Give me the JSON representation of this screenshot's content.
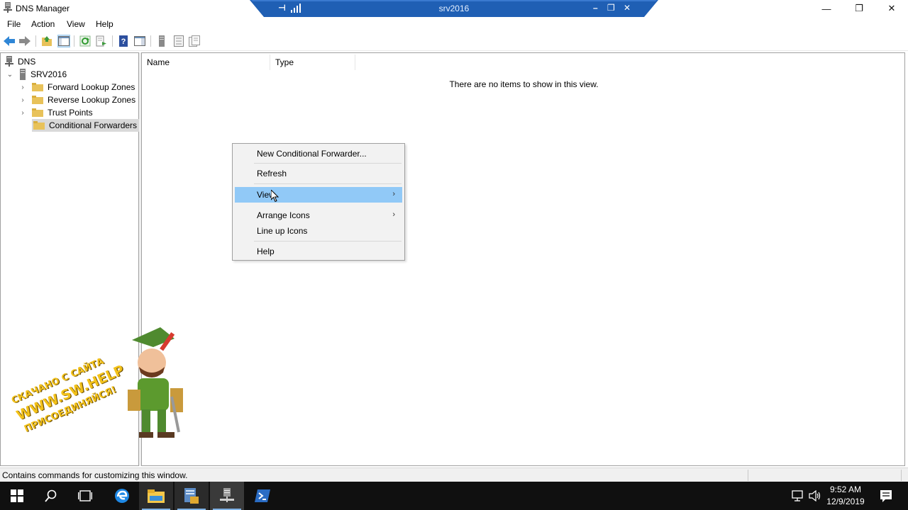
{
  "window": {
    "title": "DNS Manager",
    "minimize_glyph": "—",
    "maximize_glyph": "❐",
    "close_glyph": "✕"
  },
  "rdp": {
    "title": "srv2016",
    "pin_glyph": "⊣",
    "minimize_glyph": "–",
    "restore_glyph": "❐",
    "close_glyph": "✕"
  },
  "menu": [
    "File",
    "Action",
    "View",
    "Help"
  ],
  "tree": {
    "root": "DNS",
    "server": "SRV2016",
    "children": [
      "Forward Lookup Zones",
      "Reverse Lookup Zones",
      "Trust Points",
      "Conditional Forwarders"
    ]
  },
  "list": {
    "columns": [
      "Name",
      "Type"
    ],
    "empty_message": "There are no items to show in this view."
  },
  "context_menu": {
    "items": [
      {
        "label": "New Conditional Forwarder...",
        "submenu": false,
        "highlighted": false
      },
      {
        "label": "Refresh",
        "submenu": false,
        "highlighted": false
      },
      {
        "label": "View",
        "submenu": true,
        "highlighted": true
      },
      {
        "label": "Arrange Icons",
        "submenu": true,
        "highlighted": false
      },
      {
        "label": "Line up Icons",
        "submenu": false,
        "highlighted": false
      },
      {
        "label": "Help",
        "submenu": false,
        "highlighted": false
      }
    ],
    "submenu_glyph": "›"
  },
  "status": {
    "text": "Contains commands for customizing this window."
  },
  "watermark": {
    "line1": "СКАЧАНО С САЙТА",
    "line2": "WWW.SW.HELP",
    "line3": "ПРИСОЕДИНЯЙСЯ!"
  },
  "taskbar": {
    "time": "9:52 AM",
    "date": "12/9/2019"
  },
  "colors": {
    "rdp_bar": "#1f5fb4",
    "highlight": "#91c9f7",
    "folder": "#e8c25a",
    "taskbar": "#101010"
  }
}
